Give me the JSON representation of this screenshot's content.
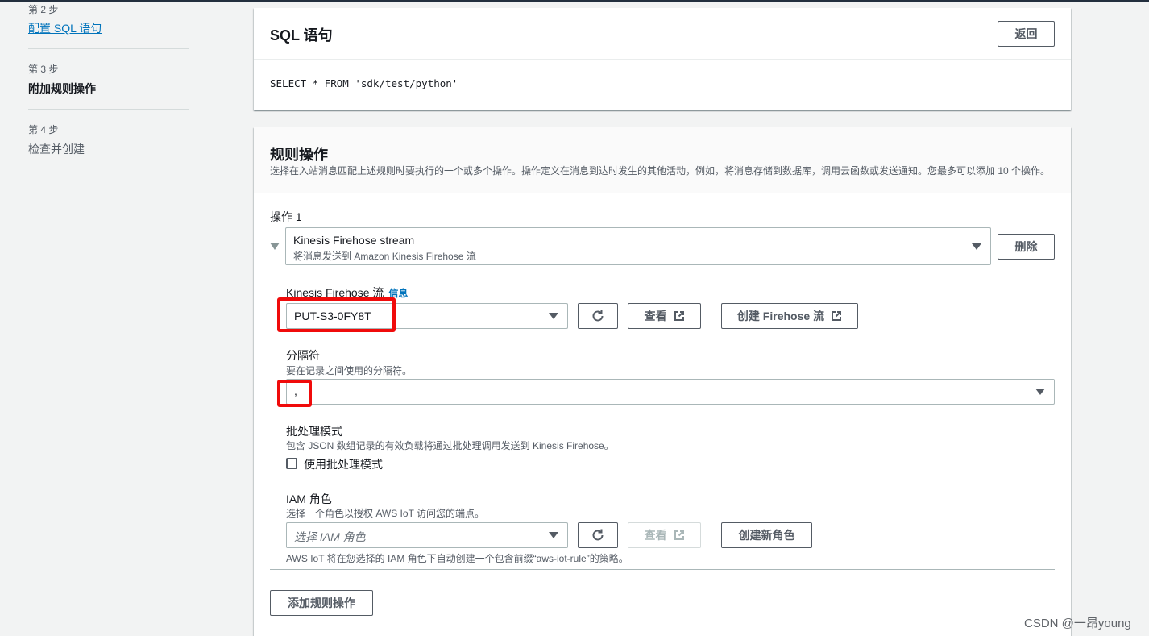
{
  "steps": [
    {
      "num": "第 2 步",
      "label": "配置 SQL 语句",
      "state": "link"
    },
    {
      "num": "第 3 步",
      "label": "附加规则操作",
      "state": "current"
    },
    {
      "num": "第 4 步",
      "label": "检查并创建",
      "state": "disabled"
    }
  ],
  "sql_panel": {
    "title": "SQL 语句",
    "back_label": "返回",
    "query": "SELECT * FROM 'sdk/test/python'"
  },
  "actions_panel": {
    "title": "规则操作",
    "description": "选择在入站消息匹配上述规则时要执行的一个或多个操作。操作定义在消息到达时发生的其他活动，例如，将消息存储到数据库，调用云函数或发送通知。您最多可以添加 10 个操作。",
    "action_label": "操作 1",
    "action_select": {
      "title": "Kinesis Firehose stream",
      "subtitle": "将消息发送到 Amazon Kinesis Firehose 流"
    },
    "delete_label": "删除",
    "firehose": {
      "label": "Kinesis Firehose 流",
      "info": "信息",
      "value": "PUT-S3-0FY8T",
      "view_label": "查看",
      "create_label": "创建 Firehose 流"
    },
    "separator": {
      "label": "分隔符",
      "hint": "要在记录之间使用的分隔符。",
      "value": ","
    },
    "batch": {
      "label": "批处理模式",
      "hint": "包含 JSON 数组记录的有效负载将通过批处理调用发送到 Kinesis Firehose。",
      "checkbox_label": "使用批处理模式"
    },
    "iam": {
      "label": "IAM 角色",
      "hint": "选择一个角色以授权 AWS IoT 访问您的端点。",
      "placeholder": "选择 IAM 角色",
      "view_label": "查看",
      "create_label": "创建新角色",
      "note": "AWS IoT 将在您选择的 IAM 角色下自动创建一个包含前缀“aws-iot-rule”的策略。"
    },
    "add_label": "添加规则操作"
  },
  "watermark": "CSDN @一昂young",
  "colors": {
    "link": "#0073bb",
    "highlight": "#f00b0b",
    "text": "#16191f",
    "muted": "#545b64"
  }
}
